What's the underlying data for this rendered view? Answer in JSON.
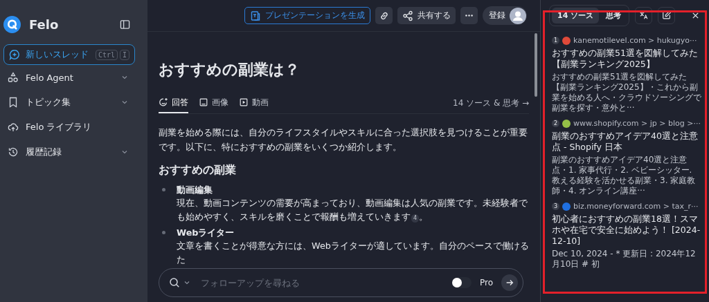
{
  "sidebar": {
    "brand": "Felo",
    "new_thread": {
      "label": "新しいスレッド",
      "shortcut": [
        "Ctrl",
        "I"
      ]
    },
    "items": [
      {
        "label": "Felo Agent",
        "expandable": true
      },
      {
        "label": "トピック集",
        "expandable": true
      },
      {
        "label": "Felo ライブラリ",
        "expandable": false
      },
      {
        "label": "履歴記録",
        "expandable": true
      }
    ]
  },
  "topbar": {
    "buttons": [
      {
        "kind": "primary",
        "label": "プレゼンテーションを生成"
      },
      {
        "kind": "link"
      },
      {
        "kind": "secondary",
        "label": "共有する"
      },
      {
        "kind": "more"
      }
    ],
    "login": "登録"
  },
  "question": "おすすめの副業は？",
  "tabs": [
    {
      "label": "回答",
      "selected": true
    },
    {
      "label": "画像",
      "selected": false
    },
    {
      "label": "動画",
      "selected": false
    }
  ],
  "sources_link": "14 ソース & 思考 →",
  "answer": {
    "intro": "副業を始める際には、自分のライフスタイルやスキルに合った選択肢を見つけることが重要です。以下に、特におすすめの副業をいくつか紹介します。",
    "heading": "おすすめの副業",
    "items": [
      {
        "title": "動画編集",
        "text": "現在、動画コンテンツの需要が高まっており、動画編集は人気の副業です。未経験者でも始めやすく、スキルを磨くことで報酬も増えていきます",
        "citation": "4",
        "end": "。"
      },
      {
        "title": "Webライター",
        "text": "文章を書くことが得意な方には、Webライターが適しています。自分のペースで働けるた"
      }
    ]
  },
  "followup": {
    "placeholder": "フォローアップを尋ねる",
    "pro_label": "Pro",
    "pro_on": false
  },
  "panel": {
    "tabs": [
      {
        "label": "14 ソース",
        "selected": true
      },
      {
        "label": "思考",
        "selected": false
      }
    ],
    "sources": [
      {
        "index": "1",
        "color": "#e04a3a",
        "site": "kanemotilevel.com > hukugyo···",
        "title": "おすすめの副業51選を図解してみた【副業ランキング2025】",
        "snippet": "おすすめの副業51選を図解してみた【副業ランキング2025】・これから副業を始める人へ・クラウドソーシングで副業を探す・意外と···"
      },
      {
        "index": "2",
        "color": "#95bf47",
        "site": "www.shopify.com > jp > blog >···",
        "title": "副業のおすすめアイデア40選と注意点 - Shopify 日本",
        "snippet": "副業のおすすめアイデア40選と注意点・1. 家事代行・2. ベビーシッター. 教える経験を活かせる副業・3. 家庭教師・4. オンライン講座···"
      },
      {
        "index": "3",
        "color": "#1f6fe0",
        "site": "biz.moneyforward.com > tax_r···",
        "title": "初心者におすすめの副業18選！スマホや在宅で安全に始めよう！ [2024-12-10]",
        "snippet": "Dec 10, 2024 - * 更新日 : 2024年12月10日 # 初"
      }
    ]
  }
}
